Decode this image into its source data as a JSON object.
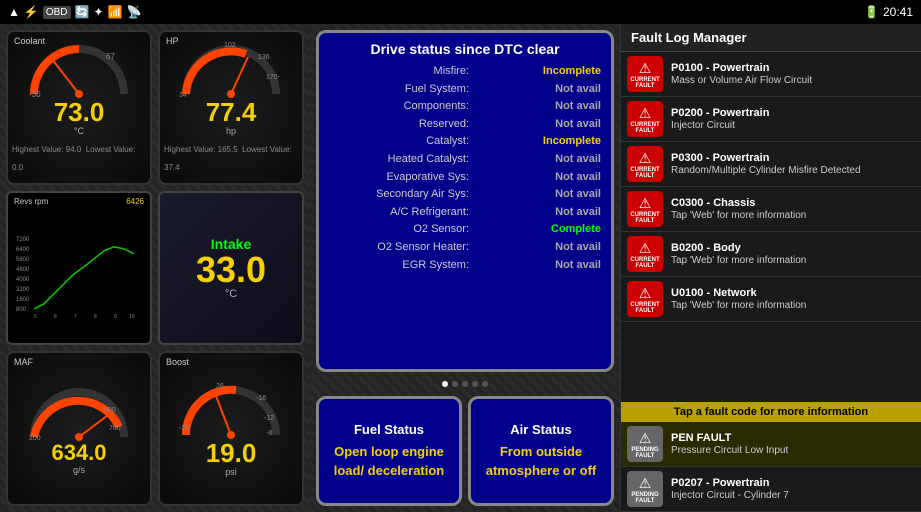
{
  "statusBar": {
    "time": "20:41",
    "icons": [
      "signal",
      "usb",
      "obd",
      "wifi",
      "bluetooth",
      "wifi-strength",
      "battery"
    ]
  },
  "gauges": {
    "coolant": {
      "label": "Coolant",
      "value": "73.0",
      "unit": "°C",
      "highest": "Highest Value: 94.0",
      "lowest": "Lowest Value: 0.0",
      "min": "-30",
      "max": "67"
    },
    "hp": {
      "label": "HP",
      "value": "77.4",
      "unit": "hp",
      "highest": "Highest Value: 165.5",
      "lowest": "Lowest Value: 37.4",
      "min": "34",
      "max": "102",
      "max2": "136",
      "max3": "170-"
    },
    "revs": {
      "label": "Revs rpm",
      "value": "6426"
    },
    "intake": {
      "label": "Intake",
      "value": "33.0",
      "unit": "°C",
      "dot_color": "green"
    },
    "maf": {
      "label": "MAF",
      "value": "634.0",
      "unit": "g/s",
      "min": "200",
      "max": "700"
    },
    "boost": {
      "label": "Boost",
      "value": "19.0",
      "unit": "psi",
      "min": "-20",
      "max": "26"
    }
  },
  "dtcStatus": {
    "title": "Drive status since DTC clear",
    "rows": [
      {
        "key": "Misfire:",
        "value": "Incomplete",
        "status": "incomplete"
      },
      {
        "key": "Fuel System:",
        "value": "Not avail",
        "status": "not-avail"
      },
      {
        "key": "Components:",
        "value": "Not avail",
        "status": "not-avail"
      },
      {
        "key": "Reserved:",
        "value": "Not avail",
        "status": "not-avail"
      },
      {
        "key": "Catalyst:",
        "value": "Incomplete",
        "status": "incomplete"
      },
      {
        "key": "Heated Catalyst:",
        "value": "Not avail",
        "status": "not-avail"
      },
      {
        "key": "Evaporative Sys:",
        "value": "Not avail",
        "status": "not-avail"
      },
      {
        "key": "Secondary Air Sys:",
        "value": "Not avail",
        "status": "not-avail"
      },
      {
        "key": "A/C Refrigerant:",
        "value": "Not avail",
        "status": "not-avail"
      },
      {
        "key": "O2 Sensor:",
        "value": "Complete",
        "status": "complete"
      },
      {
        "key": "O2 Sensor Heater:",
        "value": "Not avail",
        "status": "not-avail"
      },
      {
        "key": "EGR System:",
        "value": "Not avail",
        "status": "not-avail"
      }
    ]
  },
  "statusButtons": {
    "fuel": {
      "title": "Fuel Status",
      "value": "Open loop engine load/ deceleration"
    },
    "air": {
      "title": "Air Status",
      "value": "From outside atmosphere or off"
    }
  },
  "faultLog": {
    "title": "Fault Log Manager",
    "items": [
      {
        "code": "P0100 - Powertrain",
        "desc": "Mass or Volume Air Flow Circuit",
        "type": "CURRENT\nFAULT",
        "badgeType": "current"
      },
      {
        "code": "P0200 - Powertrain",
        "desc": "Injector Circuit",
        "type": "CURRENT\nFAULT",
        "badgeType": "current"
      },
      {
        "code": "P0300 - Powertrain",
        "desc": "Random/Multiple Cylinder Misfire\nDetected",
        "type": "CURRENT\nFAULT",
        "badgeType": "current"
      },
      {
        "code": "C0300 - Chassis",
        "desc": "Tap 'Web' for more information",
        "type": "CURRENT\nFAULT",
        "badgeType": "current"
      },
      {
        "code": "B0200 - Body",
        "desc": "Tap 'Web' for more information",
        "type": "CURRENT\nFAULT",
        "badgeType": "current"
      },
      {
        "code": "U0100 - Network",
        "desc": "Tap 'Web' for more information",
        "type": "CURRENT\nFAULT",
        "badgeType": "current"
      }
    ],
    "tapInfo": "Tap a fault code for more information",
    "pendingFault": {
      "code": "PEN FAULT",
      "desc": "Pressure Circuit Low Input",
      "type": "PENDING\nFAULT",
      "badgeType": "pending"
    },
    "pendingFault2": {
      "code": "P0207 - Powertrain",
      "desc": "Injector Circuit - Cylinder 7",
      "type": "PENDING\nFAULT",
      "badgeType": "pending"
    }
  },
  "pageDots": {
    "leftActive": 0,
    "middleActive": 0,
    "count": 5
  }
}
